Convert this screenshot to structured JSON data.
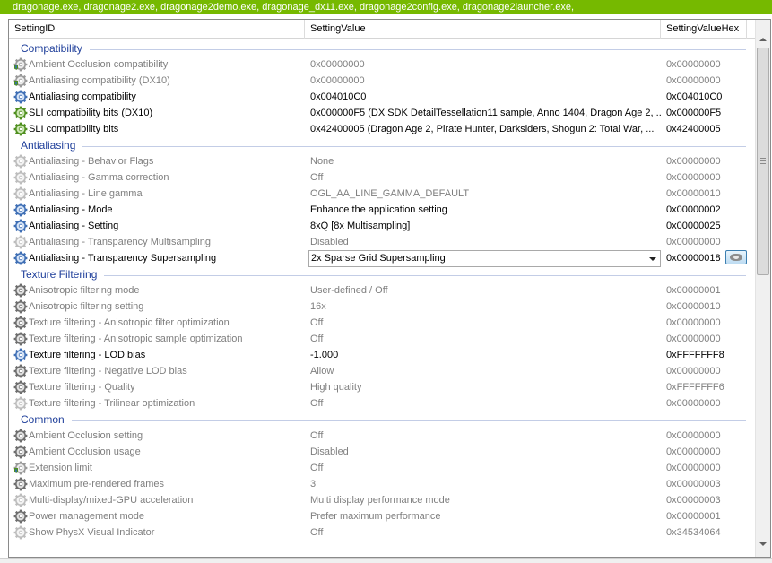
{
  "top_bar": {
    "text": "dragonage.exe, dragonage2.exe, dragonage2demo.exe, dragonage_dx11.exe, dragonage2config.exe, dragonage2launcher.exe,"
  },
  "columns": [
    {
      "label": "SettingID"
    },
    {
      "label": "SettingValue"
    },
    {
      "label": "SettingValueHex"
    }
  ],
  "colors": {
    "accent": "#76b900",
    "group_title": "#1e3e9a",
    "dim_text": "#7f7f7f"
  },
  "groups": [
    {
      "title": "Compatibility",
      "rows": [
        {
          "id": "Ambient Occlusion compatibility",
          "value": "0x00000000",
          "hex": "0x00000000",
          "icon": "gear-shield-icon",
          "dim": true
        },
        {
          "id": "Antialiasing compatibility (DX10)",
          "value": "0x00000000",
          "hex": "0x00000000",
          "icon": "gear-shield-icon",
          "dim": true
        },
        {
          "id": "Antialiasing compatibility",
          "value": "0x004010C0",
          "hex": "0x004010C0",
          "icon": "gear-blue-icon",
          "dim": false
        },
        {
          "id": "SLI compatibility bits (DX10)",
          "value": "0x000000F5 (DX SDK DetailTessellation11 sample, Anno 1404, Dragon Age 2, ...",
          "hex": "0x000000F5",
          "icon": "gear-green-icon",
          "dim": false
        },
        {
          "id": "SLI compatibility bits",
          "value": "0x42400005 (Dragon Age 2, Pirate Hunter, Darksiders, Shogun 2: Total War, ...",
          "hex": "0x42400005",
          "icon": "gear-green-icon",
          "dim": false
        }
      ]
    },
    {
      "title": "Antialiasing",
      "rows": [
        {
          "id": "Antialiasing - Behavior Flags",
          "value": "None",
          "hex": "0x00000000",
          "icon": "gear-light-icon",
          "dim": true
        },
        {
          "id": "Antialiasing - Gamma correction",
          "value": "Off",
          "hex": "0x00000000",
          "icon": "gear-light-icon",
          "dim": true
        },
        {
          "id": "Antialiasing - Line gamma",
          "value": "OGL_AA_LINE_GAMMA_DEFAULT",
          "hex": "0x00000010",
          "icon": "gear-light-icon",
          "dim": true
        },
        {
          "id": "Antialiasing - Mode",
          "value": "Enhance the application setting",
          "hex": "0x00000002",
          "icon": "gear-blue-icon",
          "dim": false
        },
        {
          "id": "Antialiasing - Setting",
          "value": "8xQ [8x Multisampling]",
          "hex": "0x00000025",
          "icon": "gear-blue-icon",
          "dim": false
        },
        {
          "id": "Antialiasing - Transparency Multisampling",
          "value": "Disabled",
          "hex": "0x00000000",
          "icon": "gear-light-icon",
          "dim": true
        },
        {
          "id": "Antialiasing - Transparency Supersampling",
          "value": "2x Sparse Grid Supersampling",
          "hex": "0x00000018",
          "icon": "gear-blue-icon",
          "dim": false,
          "editing": true
        }
      ]
    },
    {
      "title": "Texture Filtering",
      "rows": [
        {
          "id": "Anisotropic filtering mode",
          "value": "User-defined / Off",
          "hex": "0x00000001",
          "icon": "gear-gray-icon",
          "dim": true
        },
        {
          "id": "Anisotropic filtering setting",
          "value": "16x",
          "hex": "0x00000010",
          "icon": "gear-gray-icon",
          "dim": true
        },
        {
          "id": "Texture filtering - Anisotropic filter optimization",
          "value": "Off",
          "hex": "0x00000000",
          "icon": "gear-gray-icon",
          "dim": true
        },
        {
          "id": "Texture filtering - Anisotropic sample optimization",
          "value": "Off",
          "hex": "0x00000000",
          "icon": "gear-gray-icon",
          "dim": true
        },
        {
          "id": "Texture filtering - LOD bias",
          "value": "-1.000",
          "hex": "0xFFFFFFF8",
          "icon": "gear-blue-icon",
          "dim": false
        },
        {
          "id": "Texture filtering - Negative LOD bias",
          "value": "Allow",
          "hex": "0x00000000",
          "icon": "gear-gray-icon",
          "dim": true
        },
        {
          "id": "Texture filtering - Quality",
          "value": "High quality",
          "hex": "0xFFFFFFF6",
          "icon": "gear-gray-icon",
          "dim": true
        },
        {
          "id": "Texture filtering - Trilinear optimization",
          "value": "Off",
          "hex": "0x00000000",
          "icon": "gear-light-icon",
          "dim": true
        }
      ]
    },
    {
      "title": "Common",
      "rows": [
        {
          "id": "Ambient Occlusion setting",
          "value": "Off",
          "hex": "0x00000000",
          "icon": "gear-gray-icon",
          "dim": true
        },
        {
          "id": "Ambient Occlusion usage",
          "value": "Disabled",
          "hex": "0x00000000",
          "icon": "gear-gray-icon",
          "dim": true
        },
        {
          "id": "Extension limit",
          "value": "Off",
          "hex": "0x00000000",
          "icon": "gear-shield-icon",
          "dim": true
        },
        {
          "id": "Maximum pre-rendered frames",
          "value": "3",
          "hex": "0x00000003",
          "icon": "gear-gray-icon",
          "dim": true
        },
        {
          "id": "Multi-display/mixed-GPU acceleration",
          "value": "Multi display performance mode",
          "hex": "0x00000003",
          "icon": "gear-light-icon",
          "dim": true
        },
        {
          "id": "Power management mode",
          "value": "Prefer maximum performance",
          "hex": "0x00000001",
          "icon": "gear-gray-icon",
          "dim": true
        },
        {
          "id": "Show PhysX Visual Indicator",
          "value": "Off",
          "hex": "0x34534064",
          "icon": "gear-light-icon",
          "dim": true
        }
      ]
    }
  ]
}
